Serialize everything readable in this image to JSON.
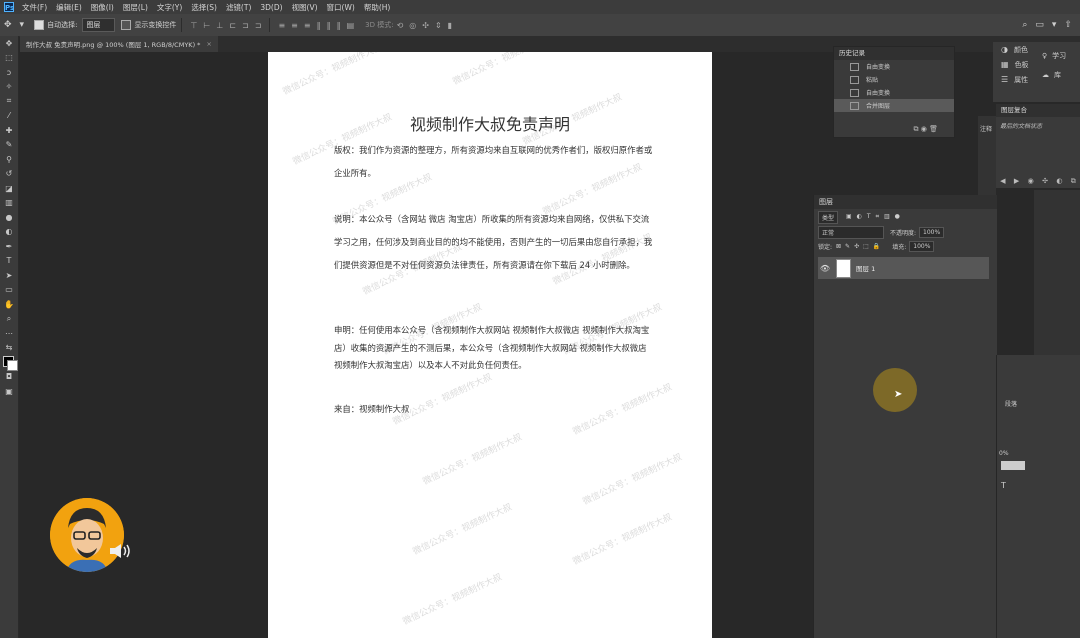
{
  "menubar": {
    "logo": "Ps",
    "items": [
      "文件(F)",
      "编辑(E)",
      "图像(I)",
      "图层(L)",
      "文字(Y)",
      "选择(S)",
      "滤镜(T)",
      "3D(D)",
      "视图(V)",
      "窗口(W)",
      "帮助(H)"
    ]
  },
  "options": {
    "auto_select_label": "自动选择:",
    "auto_select_value": "图层",
    "transform_label": "显示变换控件",
    "mode_3d": "3D 模式:"
  },
  "tab": {
    "label": "制作大叔 免责声明.png @ 100% (图层 1, RGB/8/CMYK) *",
    "close": "×"
  },
  "document": {
    "title": "视频制作大叔免责声明",
    "para1": "版权：我们作为资源的整理方，所有资源均来自互联网的优秀作者们，版权归原作者或企业所有。",
    "para2": "说明：本公众号（含网站 微店 淘宝店）所收集的所有资源均来自网络，仅供私下交流学习之用，任何涉及到商业目的的均不能使用，否则产生的一切后果由您自行承担，我们提供资源但是不对任何资源负法律责任，所有资源请在你下载后 24 小时删除。",
    "para3": "申明：任何使用本公众号（含视频制作大叔网站 视频制作大叔微店 视频制作大叔淘宝店）收集的资源产生的不测后果，本公众号（含视频制作大叔网站 视频制作大叔微店 视频制作大叔淘宝店）以及本人不对此负任何责任。",
    "para4": "来自：视频制作大叔",
    "watermark": "微信公众号：视频制作大叔"
  },
  "history": {
    "title": "历史记录",
    "items": [
      "自由变换",
      "粘贴",
      "自由变换",
      "合并图层"
    ],
    "active_index": 3
  },
  "color_panel": {
    "items": [
      "颜色",
      "色板",
      "属性"
    ],
    "library": [
      "学习",
      "库"
    ]
  },
  "layer_comps": {
    "title": "图层复合",
    "state": "最后的文档状态"
  },
  "annotation": {
    "label": "注释"
  },
  "layers": {
    "title": "图层",
    "filter_kind": "类型",
    "blend_mode": "正常",
    "opacity_label": "不透明度:",
    "opacity_value": "100%",
    "lock_label": "锁定:",
    "fill_label": "填充:",
    "fill_value": "100%",
    "layer_name": "图层 1"
  },
  "right_extra": {
    "a": "段落",
    "b": "0%"
  }
}
